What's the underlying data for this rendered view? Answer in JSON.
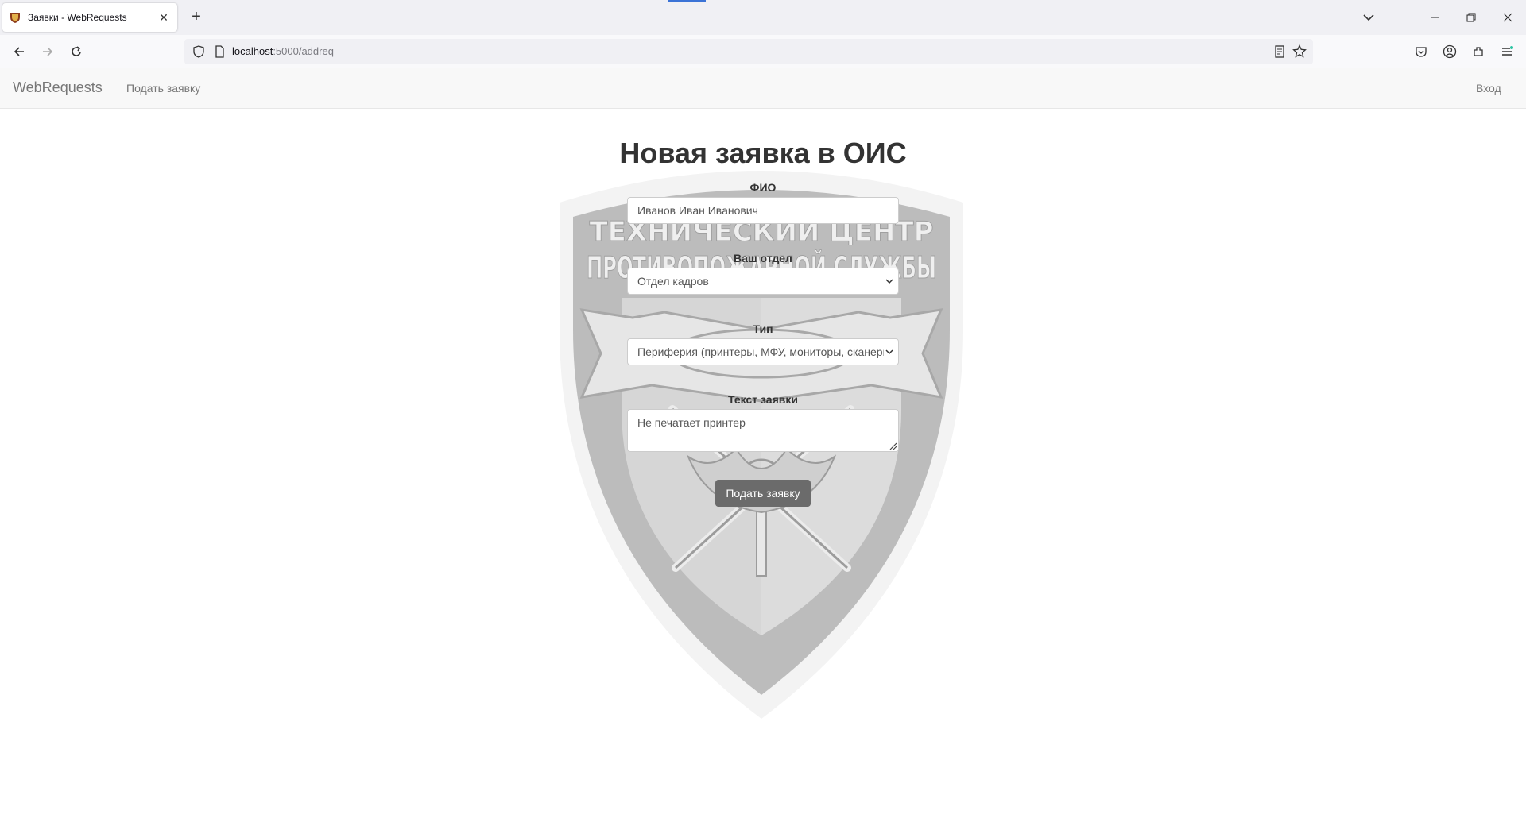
{
  "browser": {
    "tab_title": "Заявки - WebRequests",
    "url_host": "localhost",
    "url_path": ":5000/addreq"
  },
  "site_nav": {
    "brand": "WebRequests",
    "submit_link": "Подать заявку",
    "login_link": "Вход"
  },
  "page": {
    "title": "Новая заявка в ОИС",
    "emblem_text_top": "ТЕХНИЧЕСКИЙ ЦЕНТР",
    "emblem_text_main": "ПРОТИВОПОЖАРНОЙ СЛУЖБЫ"
  },
  "form": {
    "fio_label": "ФИО",
    "fio_value": "Иванов Иван Иванович",
    "dept_label": "Ваш отдел",
    "dept_value": "Отдел кадров",
    "type_label": "Тип",
    "type_value": "Периферия (принтеры, МФУ, мониторы, сканеры)",
    "text_label": "Текст заявки",
    "text_value": "Не печатает принтер",
    "submit_label": "Подать заявку"
  }
}
